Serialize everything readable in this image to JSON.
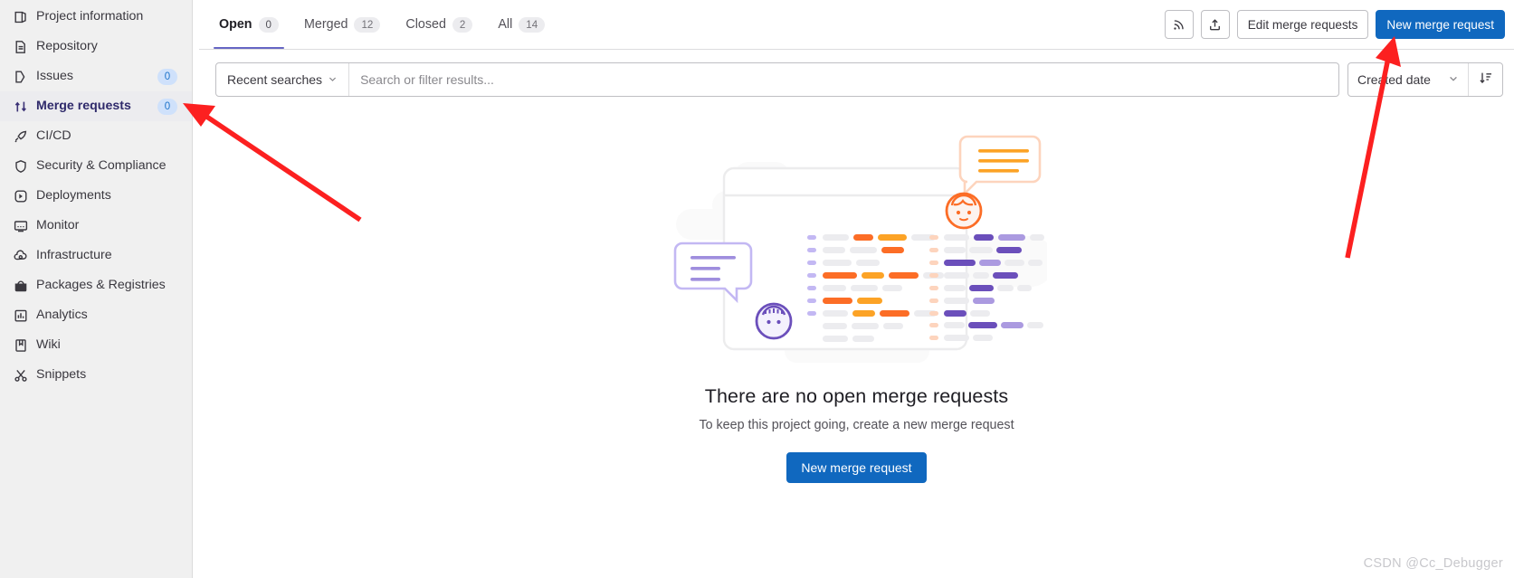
{
  "sidebar": {
    "items": [
      {
        "label": "Project information",
        "icon": "project-information-icon",
        "badge": null,
        "active": false
      },
      {
        "label": "Repository",
        "icon": "repository-icon",
        "badge": null,
        "active": false
      },
      {
        "label": "Issues",
        "icon": "issues-icon",
        "badge": "0",
        "active": false
      },
      {
        "label": "Merge requests",
        "icon": "merge-requests-icon",
        "badge": "0",
        "active": true
      },
      {
        "label": "CI/CD",
        "icon": "ci-cd-icon",
        "badge": null,
        "active": false
      },
      {
        "label": "Security & Compliance",
        "icon": "shield-icon",
        "badge": null,
        "active": false
      },
      {
        "label": "Deployments",
        "icon": "deployments-icon",
        "badge": null,
        "active": false
      },
      {
        "label": "Monitor",
        "icon": "monitor-icon",
        "badge": null,
        "active": false
      },
      {
        "label": "Infrastructure",
        "icon": "infrastructure-icon",
        "badge": null,
        "active": false
      },
      {
        "label": "Packages & Registries",
        "icon": "package-icon",
        "badge": null,
        "active": false
      },
      {
        "label": "Analytics",
        "icon": "analytics-icon",
        "badge": null,
        "active": false
      },
      {
        "label": "Wiki",
        "icon": "wiki-icon",
        "badge": null,
        "active": false
      },
      {
        "label": "Snippets",
        "icon": "snippets-icon",
        "badge": null,
        "active": false
      }
    ]
  },
  "tabs": [
    {
      "label": "Open",
      "count": "0",
      "selected": true
    },
    {
      "label": "Merged",
      "count": "12",
      "selected": false
    },
    {
      "label": "Closed",
      "count": "2",
      "selected": false
    },
    {
      "label": "All",
      "count": "14",
      "selected": false
    }
  ],
  "toolbar": {
    "rss_icon": "rss-feed-icon",
    "export_icon": "export-upload-icon",
    "edit_label": "Edit merge requests",
    "new_label": "New merge request"
  },
  "filter": {
    "recent_searches_label": "Recent searches",
    "search_placeholder": "Search or filter results...",
    "search_value": "",
    "sort_value": "Created date",
    "sort_direction_icon": "sort-descending-icon"
  },
  "empty_state": {
    "title": "There are no open merge requests",
    "description": "To keep this project going, create a new merge request",
    "cta_label": "New merge request"
  },
  "watermark": {
    "text": "CSDN @Cc_Debugger"
  },
  "colors": {
    "primary_button": "#1068bf",
    "active_tab_underline": "#6666c4",
    "badge_blue_bg": "#cfe1fb",
    "badge_blue_text": "#1f75cb",
    "annotation_arrow": "#fc2020",
    "sidebar_bg": "#f0f0f0"
  },
  "annotations": [
    {
      "name": "arrow-to-merge-requests",
      "color": "#fc2020"
    },
    {
      "name": "arrow-to-new-merge-request-button",
      "color": "#fc2020"
    }
  ]
}
